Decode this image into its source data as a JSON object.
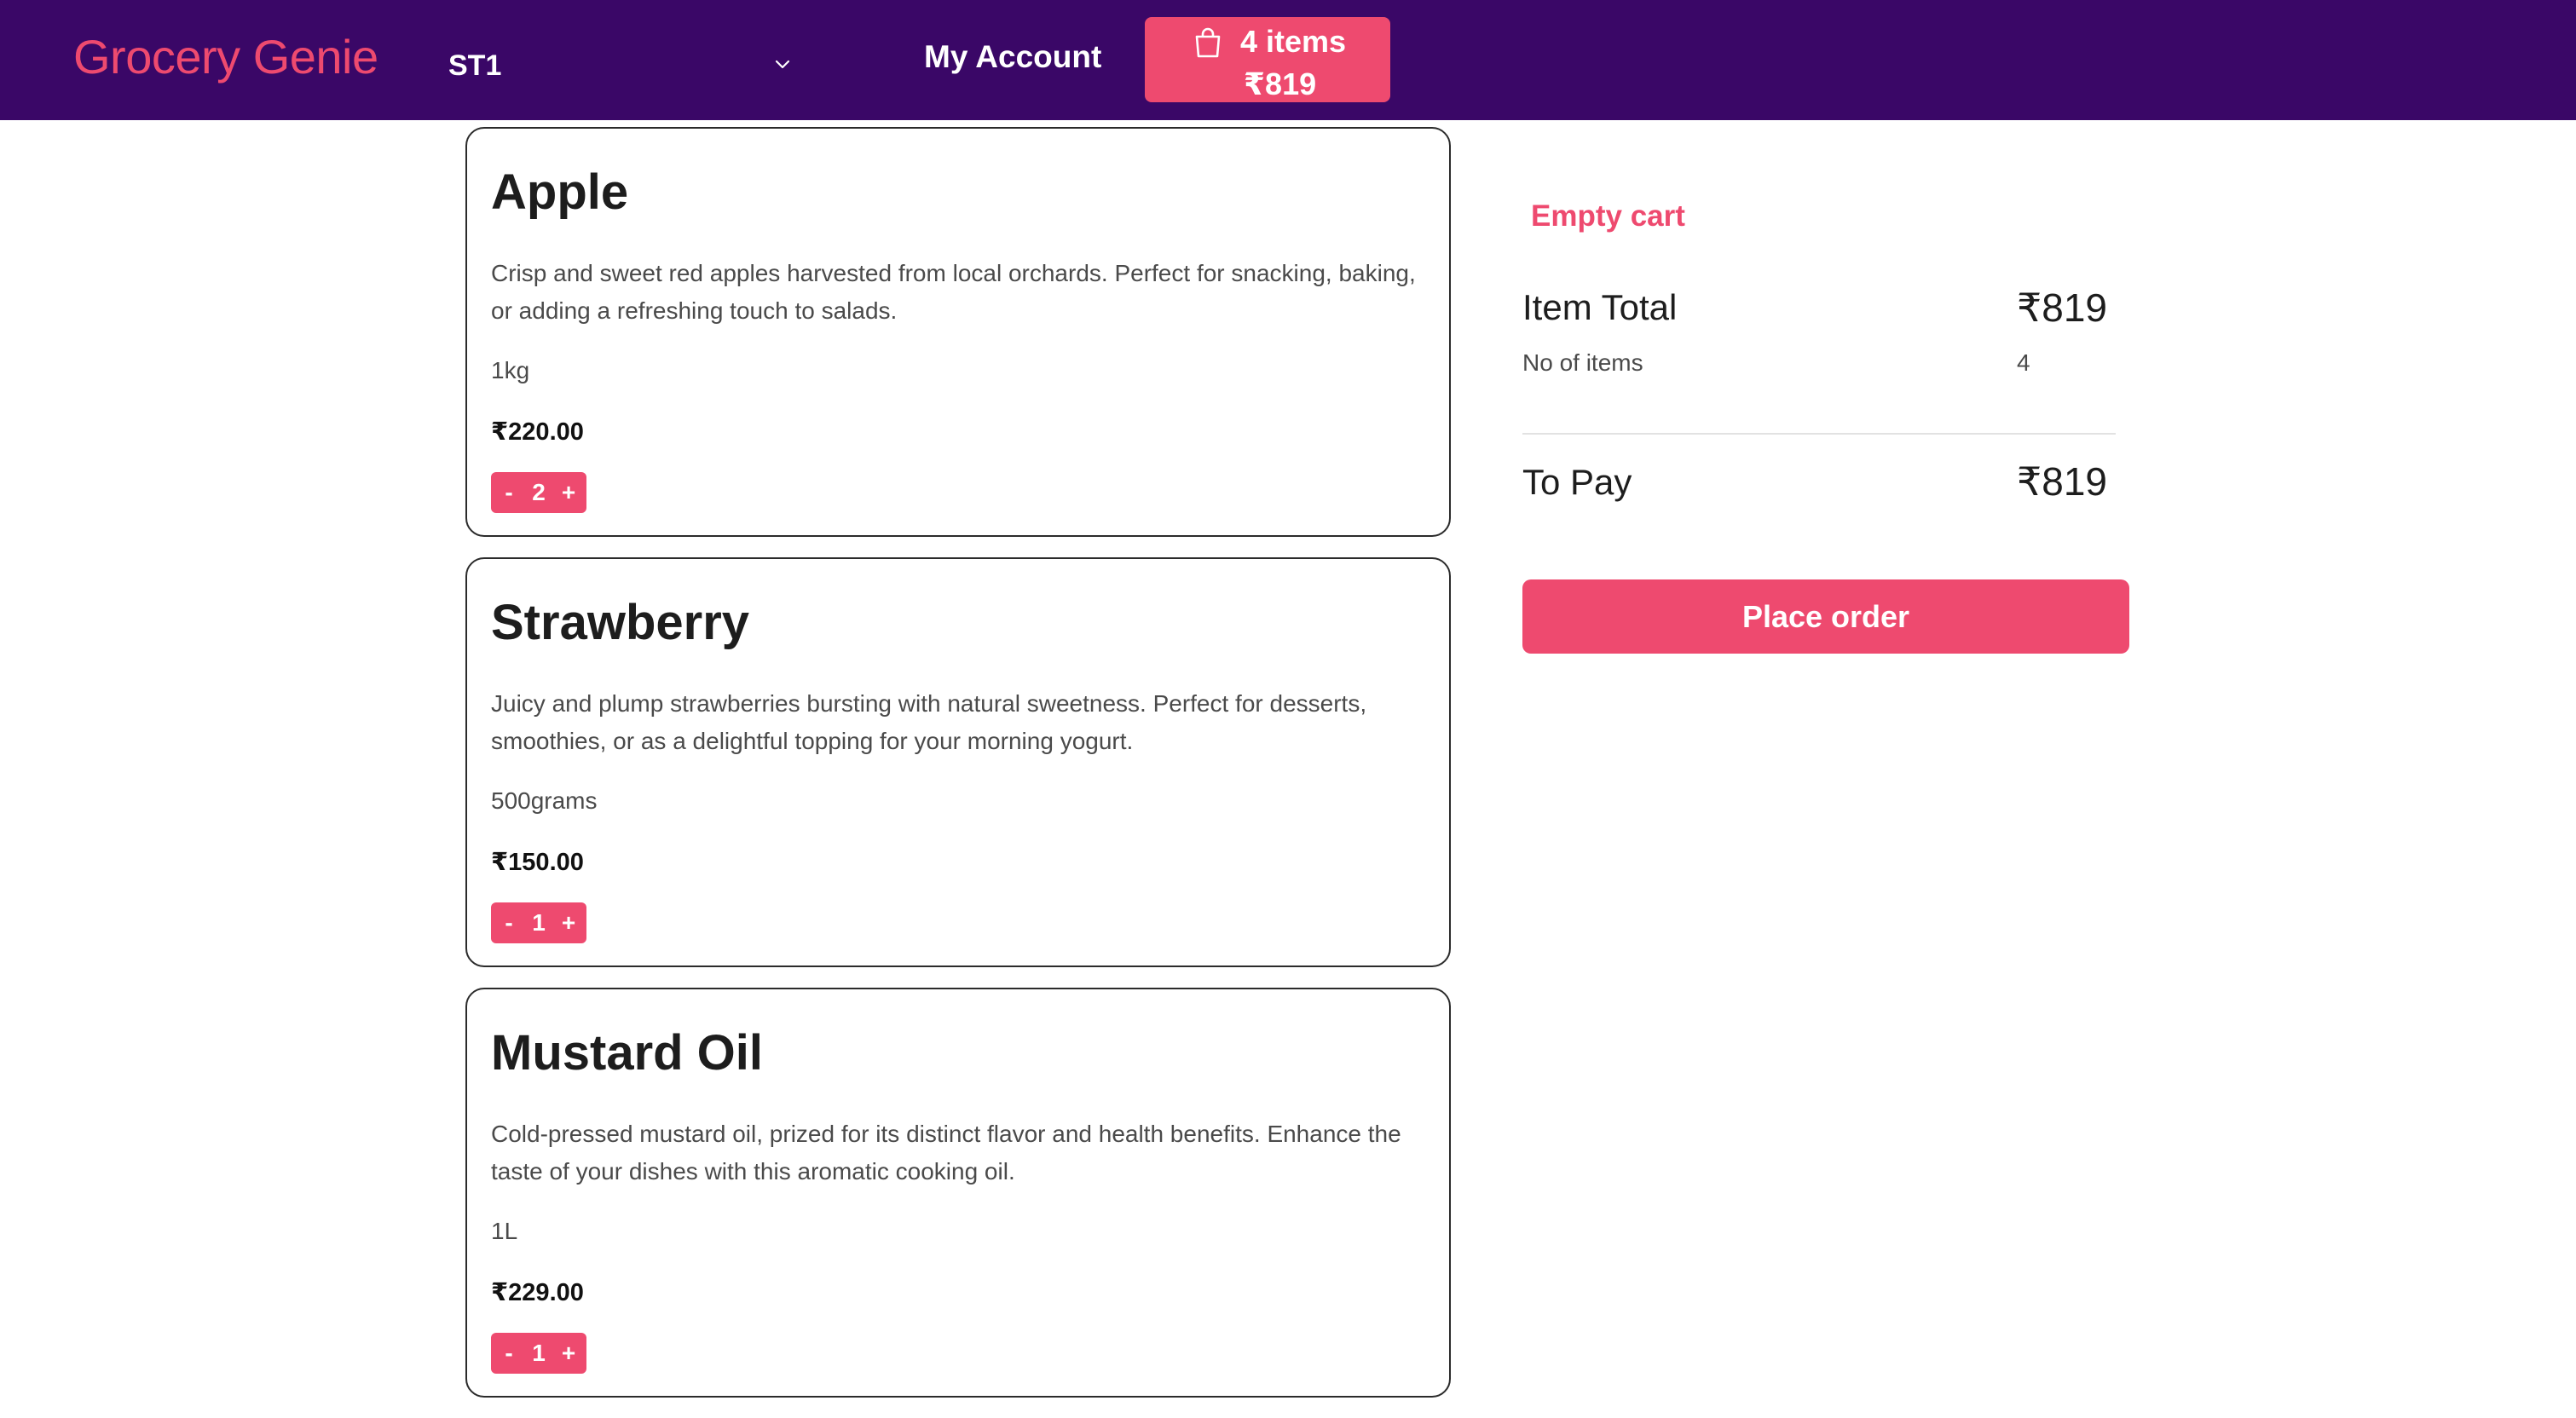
{
  "header": {
    "brand": "Grocery Genie",
    "store_selected": "ST1",
    "account_label": "My Account",
    "cart": {
      "count_label": "4 items",
      "amount": "₹819",
      "icon": "shopping-bag-icon"
    }
  },
  "colors": {
    "header_bg": "#3a0767",
    "accent": "#ee4a6f"
  },
  "products": [
    {
      "name": "Apple",
      "description": "Crisp and sweet red apples harvested from local orchards. Perfect for snacking, baking, or adding a refreshing touch to salads.",
      "size": "1kg",
      "price": "₹220.00",
      "quantity": "2"
    },
    {
      "name": "Strawberry",
      "description": "Juicy and plump strawberries bursting with natural sweetness. Perfect for desserts, smoothies, or as a delightful topping for your morning yogurt.",
      "size": "500grams",
      "price": "₹150.00",
      "quantity": "1"
    },
    {
      "name": "Mustard Oil",
      "description": "Cold-pressed mustard oil, prized for its distinct flavor and health benefits. Enhance the taste of your dishes with this aromatic cooking oil.",
      "size": "1L",
      "price": "₹229.00",
      "quantity": "1"
    }
  ],
  "stepper": {
    "minus": "-",
    "plus": "+"
  },
  "summary": {
    "empty_cart_label": "Empty cart",
    "item_total_label": "Item Total",
    "item_total_value": "₹819",
    "count_label": "No of items",
    "count_value": "4",
    "to_pay_label": "To Pay",
    "to_pay_value": "₹819",
    "place_order_label": "Place order"
  }
}
